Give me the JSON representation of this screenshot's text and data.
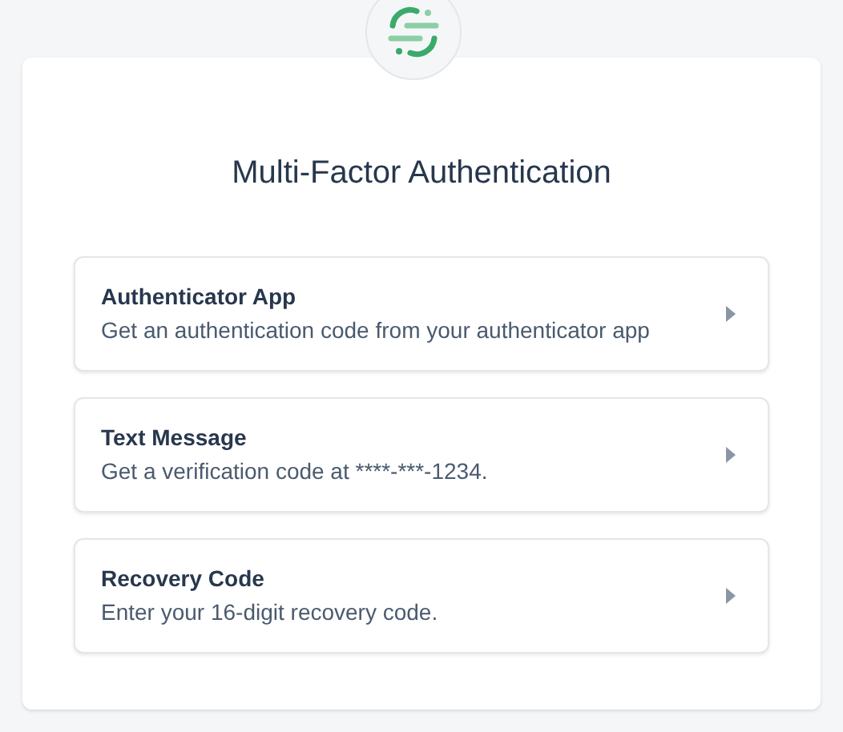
{
  "title": "Multi-Factor Authentication",
  "options": [
    {
      "name": "Authenticator App",
      "description": "Get an authentication code from your authenticator app"
    },
    {
      "name": "Text Message",
      "description": "Get a verification code at ****-***-1234."
    },
    {
      "name": "Recovery Code",
      "description": "Enter your 16-digit recovery code."
    }
  ]
}
